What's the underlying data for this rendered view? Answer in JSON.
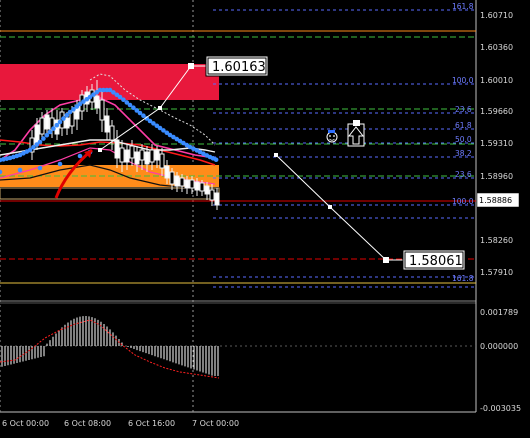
{
  "price_axis": {
    "ticks": [
      "1.60710",
      "1.60360",
      "1.60010",
      "1.59660",
      "1.59310",
      "1.58960",
      "1.58260",
      "1.57910"
    ],
    "current": "1.58886"
  },
  "oscillator_axis": {
    "ticks": [
      "0.001789",
      "0.000000",
      "-0.003035"
    ]
  },
  "time_axis": {
    "ticks": [
      "6 Oct 00:00",
      "6 Oct 08:00",
      "6 Oct 16:00",
      "7 Oct 00:00"
    ]
  },
  "callouts": {
    "high": "1.60163",
    "low": "1.58061"
  },
  "fib_top": [
    "161.8",
    "100.0",
    "23.6",
    "61.8",
    "50.0",
    "38.2",
    "23.6",
    "100.0"
  ],
  "fib_bottom": [
    "161.8"
  ],
  "colors": {
    "background": "#000000",
    "supply_zone": "#e8183c",
    "demand_zone": "#ff8c1a",
    "fib_lines": "#5a6cff",
    "upper_band": "#ff3da6",
    "ma_dots": "#3a8cff",
    "current_price_line": "#e00000",
    "hist_bars": "#ffffff",
    "signal_line": "#ff2020"
  },
  "icons": [
    "up-arrow-icon",
    "smiley-icon",
    "red-arrow-icon"
  ]
}
